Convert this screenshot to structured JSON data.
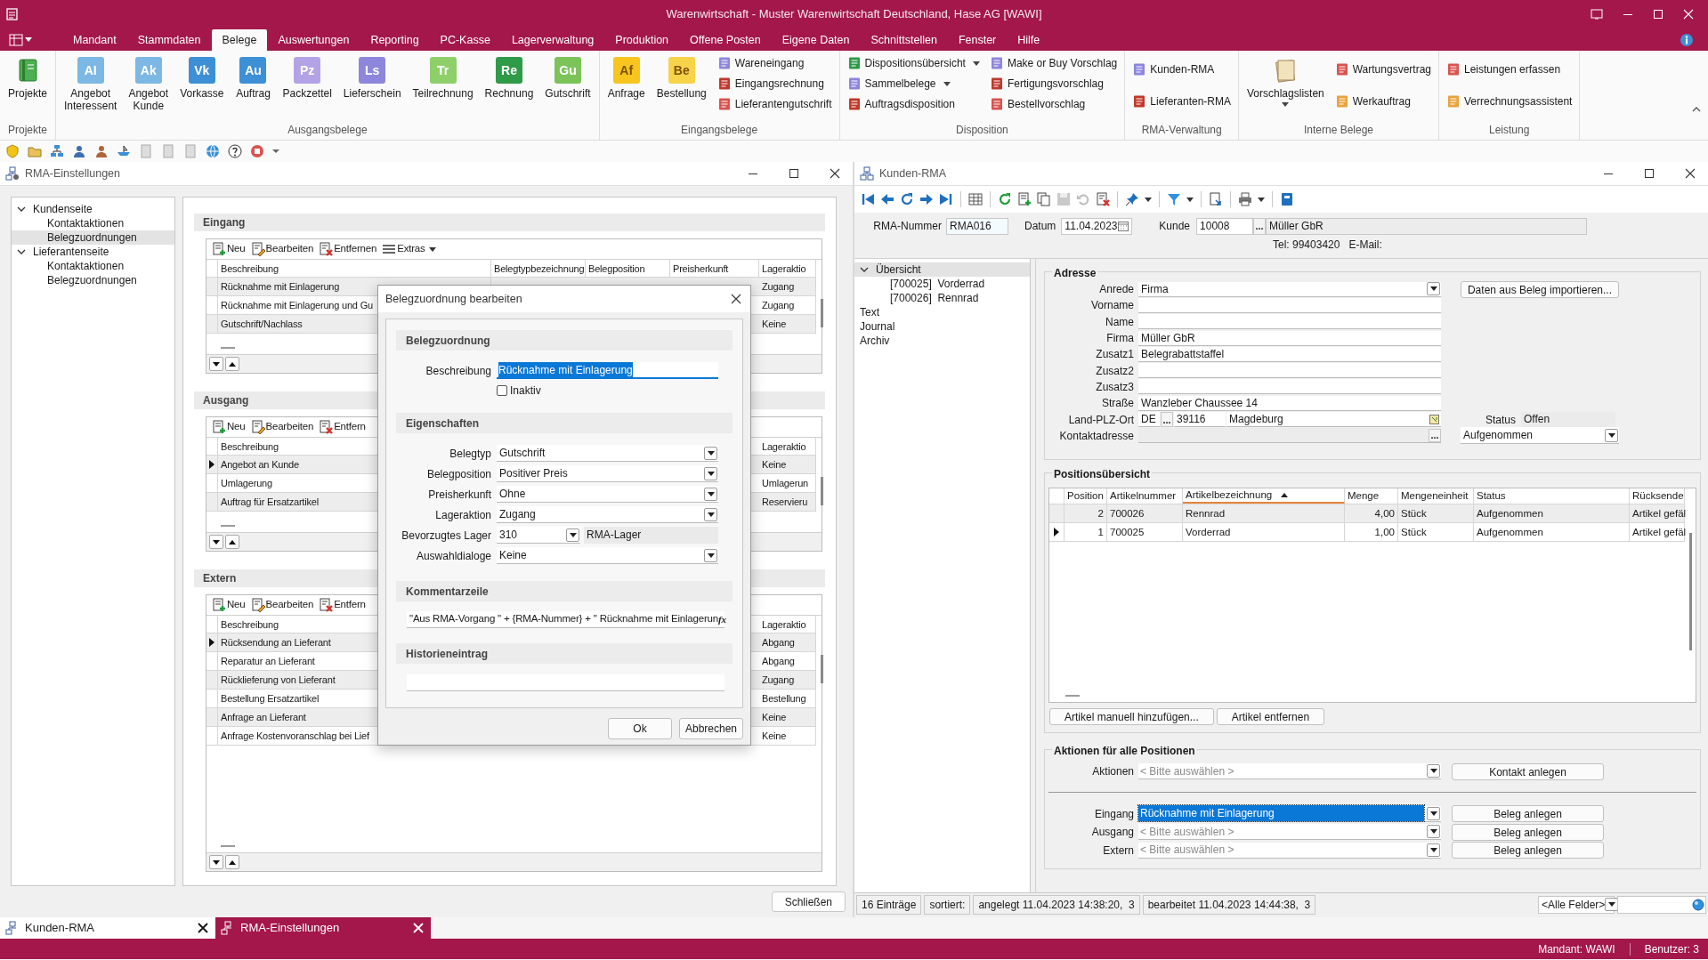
{
  "app": {
    "title": "Warenwirtschaft - Muster Warenwirtschaft Deutschland, Hase AG [WAWI]"
  },
  "menu_tabs": [
    {
      "label": "Mandant",
      "selected": false
    },
    {
      "label": "Stammdaten",
      "selected": false
    },
    {
      "label": "Belege",
      "selected": true
    },
    {
      "label": "Auswertungen",
      "selected": false
    },
    {
      "label": "Reporting",
      "selected": false
    },
    {
      "label": "PC-Kasse",
      "selected": false
    },
    {
      "label": "Lagerverwaltung",
      "selected": false
    },
    {
      "label": "Produktion",
      "selected": false
    },
    {
      "label": "Offene Posten",
      "selected": false
    },
    {
      "label": "Eigene Daten",
      "selected": false
    },
    {
      "label": "Schnittstellen",
      "selected": false
    },
    {
      "label": "Fenster",
      "selected": false
    },
    {
      "label": "Hilfe",
      "selected": false
    }
  ],
  "ribbon_groups": [
    {
      "label": "Projekte",
      "items": [
        {
          "kind": "book",
          "label": "Projekte"
        }
      ]
    },
    {
      "label": "Ausgangsbelege",
      "items": [
        {
          "kind": "large",
          "label": "Angebot\nInteressent",
          "glyph": "AI",
          "color": "#7db7e3"
        },
        {
          "kind": "large",
          "label": "Angebot\nKunde",
          "glyph": "Ak",
          "color": "#7db7e3"
        },
        {
          "kind": "large",
          "label": "Vorkasse",
          "glyph": "Vk",
          "color": "#3d8fd6"
        },
        {
          "kind": "large",
          "label": "Auftrag",
          "glyph": "Au",
          "color": "#3d8fd6"
        },
        {
          "kind": "large",
          "label": "Packzettel",
          "glyph": "Pz",
          "color": "#b3a3e6"
        },
        {
          "kind": "large",
          "label": "Lieferschein",
          "glyph": "Ls",
          "color": "#8d86dc"
        },
        {
          "kind": "large",
          "label": "Teilrechnung",
          "glyph": "Tr",
          "color": "#8fcf6a"
        },
        {
          "kind": "large",
          "label": "Rechnung",
          "glyph": "Re",
          "color": "#2f9a48"
        },
        {
          "kind": "large",
          "label": "Gutschrift",
          "glyph": "Gu",
          "color": "#7cc35a"
        }
      ]
    },
    {
      "label": "Eingangsbelege",
      "items": [
        {
          "kind": "large",
          "label": "Anfrage",
          "glyph": "Af",
          "color": "#f7c51e"
        },
        {
          "kind": "large",
          "label": "Bestellung",
          "glyph": "Be",
          "color": "#f7d34a"
        },
        {
          "kind": "stack",
          "items": [
            {
              "label": "Wareneingang",
              "has_menu": false
            },
            {
              "label": "Eingangsrechnung",
              "has_menu": false
            },
            {
              "label": "Lieferantengutschrift",
              "has_menu": false
            }
          ]
        }
      ]
    },
    {
      "label": "Disposition",
      "items": [
        {
          "kind": "stack",
          "items": [
            {
              "label": "Dispositionsübersicht",
              "has_menu": true
            },
            {
              "label": "Sammelbelege",
              "has_menu": true
            },
            {
              "label": "Auftragsdisposition",
              "has_menu": false
            }
          ]
        },
        {
          "kind": "stack",
          "items": [
            {
              "label": "Make or Buy Vorschlag",
              "has_menu": false
            },
            {
              "label": "Fertigungsvorschlag",
              "has_menu": false
            },
            {
              "label": "Bestellvorschlag",
              "has_menu": false
            }
          ]
        }
      ]
    },
    {
      "label": "RMA-Verwaltung",
      "items": [
        {
          "kind": "stack",
          "items": [
            {
              "label": "Kunden-RMA",
              "has_menu": false
            },
            {
              "label": "Lieferanten-RMA",
              "has_menu": false
            }
          ]
        }
      ]
    },
    {
      "label": "Interne Belege",
      "items": [
        {
          "kind": "list",
          "label": "Vorschlagslisten",
          "has_menu": true
        },
        {
          "kind": "stack",
          "items": [
            {
              "label": "Wartungsvertrag",
              "has_menu": false
            },
            {
              "label": "Werkauftrag",
              "has_menu": false
            }
          ]
        }
      ]
    },
    {
      "label": "Leistung",
      "items": [
        {
          "kind": "stack",
          "items": [
            {
              "label": "Leistungen erfassen",
              "has_menu": false
            },
            {
              "label": "Verrechnungsassistent",
              "has_menu": false
            }
          ]
        }
      ]
    }
  ],
  "settings_window": {
    "title": "RMA-Einstellungen",
    "tree": [
      {
        "label": "Kundenseite",
        "expanded": true,
        "selected": false,
        "children": [
          {
            "label": "Kontaktaktionen",
            "selected": false
          },
          {
            "label": "Belegzuordnungen",
            "selected": true
          }
        ]
      },
      {
        "label": "Lieferantenseite",
        "expanded": true,
        "selected": false,
        "children": [
          {
            "label": "Kontaktaktionen",
            "selected": false
          },
          {
            "label": "Belegzuordnungen",
            "selected": false
          }
        ]
      }
    ],
    "sections": [
      {
        "title": "Eingang",
        "toolbar": [
          {
            "kind": "add",
            "label": "Neu"
          },
          {
            "kind": "edit",
            "label": "Bearbeiten"
          },
          {
            "kind": "delete",
            "label": "Entfernen"
          },
          {
            "kind": "menu",
            "label": "Extras"
          }
        ],
        "columns": [
          {
            "kind": "description",
            "label": "Beschreibung"
          },
          {
            "kind": "type",
            "label": "Belegtypbezeichnung"
          },
          {
            "kind": "position",
            "label": "Belegposition"
          },
          {
            "kind": "price",
            "label": "Preisherkunft"
          },
          {
            "kind": "action",
            "label": "Lageraktio"
          }
        ],
        "rows": [
          {
            "description": "Rücknahme mit Einlagerung",
            "action": "Zugang",
            "current": false
          },
          {
            "description": "Rücknahme mit Einlagerung und Gu",
            "action": "Zugang",
            "current": false
          },
          {
            "description": "Gutschrift/Nachlass",
            "action": "Keine",
            "current": false
          }
        ]
      },
      {
        "title": "Ausgang",
        "toolbar": [
          {
            "kind": "add",
            "label": "Neu"
          },
          {
            "kind": "edit",
            "label": "Bearbeiten"
          },
          {
            "kind": "delete",
            "label": "Entfern"
          }
        ],
        "columns": [
          {
            "kind": "description",
            "label": "Beschreibung"
          },
          {
            "kind": "action",
            "label": "Lageraktio"
          }
        ],
        "rows": [
          {
            "description": "Angebot an Kunde",
            "action": "Keine",
            "current": true
          },
          {
            "description": "Umlagerung",
            "action": "Umlagerun",
            "current": false
          },
          {
            "description": "Auftrag für Ersatzartikel",
            "action": "Reservieru",
            "current": false
          }
        ]
      },
      {
        "title": "Extern",
        "toolbar": [
          {
            "kind": "add",
            "label": "Neu"
          },
          {
            "kind": "edit",
            "label": "Bearbeiten"
          },
          {
            "kind": "delete",
            "label": "Entfern"
          }
        ],
        "columns": [
          {
            "kind": "description",
            "label": "Beschreibung"
          },
          {
            "kind": "action",
            "label": "Lageraktio"
          }
        ],
        "rows": [
          {
            "description": "Rücksendung an Lieferant",
            "action": "Abgang",
            "current": true
          },
          {
            "description": "Reparatur an Lieferant",
            "action": "Abgang",
            "current": false
          },
          {
            "description": "Rücklieferung von Lieferant",
            "action": "Zugang",
            "current": false
          },
          {
            "description": "Bestellung Ersatzartikel",
            "action": "Bestellung",
            "current": false
          },
          {
            "description": "Anfrage an Lieferant",
            "action": "Keine",
            "current": false
          },
          {
            "description": "Anfrage Kostenvoranschlag bei Lief",
            "action": "Keine",
            "current": false
          }
        ]
      }
    ],
    "close_button": "Schließen"
  },
  "dialog": {
    "title": "Belegzuordnung bearbeiten",
    "sections": [
      {
        "title": "Belegzuordnung"
      },
      {
        "title": "Eigenschaften"
      },
      {
        "title": "Kommentarzeile"
      },
      {
        "title": "Historieneintrag"
      }
    ],
    "description": {
      "label": "Beschreibung",
      "value": "Rücknahme mit Einlagerung"
    },
    "inactive": {
      "label": "Inaktiv",
      "checked": false
    },
    "properties": [
      {
        "label": "Belegtyp",
        "value": "Gutschrift"
      },
      {
        "label": "Belegposition",
        "value": "Positiver Preis"
      },
      {
        "label": "Preisherkunft",
        "value": "Ohne"
      },
      {
        "label": "Lageraktion",
        "value": "Zugang"
      },
      {
        "label": "Bevorzugtes Lager",
        "value": "310",
        "note": "RMA-Lager"
      },
      {
        "label": "Auswahldialoge",
        "value": "Keine"
      }
    ],
    "comment": {
      "value": "\"Aus RMA-Vorgang \" + {RMA-Nummer} + \" Rücknahme mit Einlagerun",
      "formula_button": "fx"
    },
    "buttons": [
      "Ok",
      "Abbrechen"
    ]
  },
  "rma_window": {
    "title": "Kunden-RMA",
    "header": {
      "rma_label": "RMA-Nummer",
      "rma_value": "RMA016",
      "date_label": "Datum",
      "date_value": "11.04.2023",
      "customer_label": "Kunde",
      "customer_no": "10008",
      "lookup_button": "...",
      "customer_name": "Müller GbR",
      "phone": "Tel: 99403420",
      "email": "E-Mail:"
    },
    "tree": [
      {
        "label": "Übersicht",
        "expanded": true,
        "selected": true,
        "children": [
          {
            "label": "[700025]  Vorderrad",
            "selected": false
          },
          {
            "label": "[700026]  Rennrad",
            "selected": false
          }
        ]
      },
      {
        "label": "Text",
        "selected": false
      },
      {
        "label": "Journal",
        "selected": false
      },
      {
        "label": "Archiv",
        "selected": false
      }
    ],
    "address": {
      "title": "Adresse",
      "fields": [
        {
          "kind": "select",
          "label": "Anrede",
          "value": "Firma",
          "side": {
            "kind": "button",
            "label": "Daten aus Beleg importieren..."
          }
        },
        {
          "kind": "text",
          "label": "Vorname"
        },
        {
          "kind": "text",
          "label": "Name"
        },
        {
          "kind": "text",
          "label": "Firma",
          "value": "Müller GbR"
        },
        {
          "kind": "text",
          "label": "Zusatz1",
          "value": "Belegrabattstaffel"
        },
        {
          "kind": "text",
          "label": "Zusatz2"
        },
        {
          "kind": "text",
          "label": "Zusatz3"
        },
        {
          "kind": "text",
          "label": "Straße",
          "value": "Wanzleber Chaussee 14"
        },
        {
          "kind": "location",
          "label": "Land-PLZ-Ort",
          "country": "DE",
          "lookup_button": "...",
          "zip": "39116",
          "city": "Magdeburg",
          "side": {
            "kind": "status",
            "label": "Status",
            "value": "Offen"
          }
        },
        {
          "kind": "lookup",
          "label": "Kontaktadresse",
          "lookup_button": "...",
          "side": {
            "kind": "select",
            "value": "Aufgenommen"
          }
        }
      ]
    },
    "positions": {
      "title": "Positionsübersicht",
      "columns": [
        {
          "label": "Position",
          "sorted": false
        },
        {
          "label": "Artikelnummer",
          "sorted": false
        },
        {
          "label": "Artikelbezeichnung",
          "sorted": true
        },
        {
          "label": "Menge",
          "sorted": false
        },
        {
          "label": "Mengeneinheit",
          "sorted": false
        },
        {
          "label": "Status",
          "sorted": false
        },
        {
          "label": "Rücksende",
          "sorted": false
        }
      ],
      "rows": [
        {
          "current": false,
          "cells": [
            "2",
            "700026",
            "Rennrad",
            "4,00",
            "Stück",
            "Aufgenommen",
            "Artikel gefäl"
          ]
        },
        {
          "current": true,
          "cells": [
            "1",
            "700025",
            "Vorderrad",
            "1,00",
            "Stück",
            "Aufgenommen",
            "Artikel gefäl"
          ]
        }
      ],
      "buttons": [
        "Artikel manuell hinzufügen...",
        "Artikel entfernen"
      ]
    },
    "actions": {
      "title": "Aktionen für alle Positionen",
      "rows": [
        {
          "label": "Aktionen",
          "placeholder": "< Bitte auswählen >",
          "button": "Kontakt anlegen"
        },
        {
          "label": "Eingang",
          "value": "Rücknahme mit Einlagerung",
          "highlighted": true,
          "button": "Beleg anlegen"
        },
        {
          "label": "Ausgang",
          "placeholder": "< Bitte auswählen >",
          "button": "Beleg anlegen"
        },
        {
          "label": "Extern",
          "placeholder": "< Bitte auswählen >",
          "button": "Beleg anlegen"
        }
      ]
    },
    "status_bar": {
      "count": "16 Einträge",
      "sorted": "sortiert:",
      "created": "angelegt 11.04.2023 14:38:20,  3",
      "edited": "bearbeitet 11.04.2023 14:44:38,  3",
      "filter": "<Alle Felder>"
    }
  },
  "window_tabs": [
    {
      "label": "Kunden-RMA",
      "selected": false
    },
    {
      "label": "RMA-Einstellungen",
      "selected": true
    }
  ],
  "footer": {
    "mandant": "Mandant: WAWI",
    "user": "Benutzer: 3"
  }
}
